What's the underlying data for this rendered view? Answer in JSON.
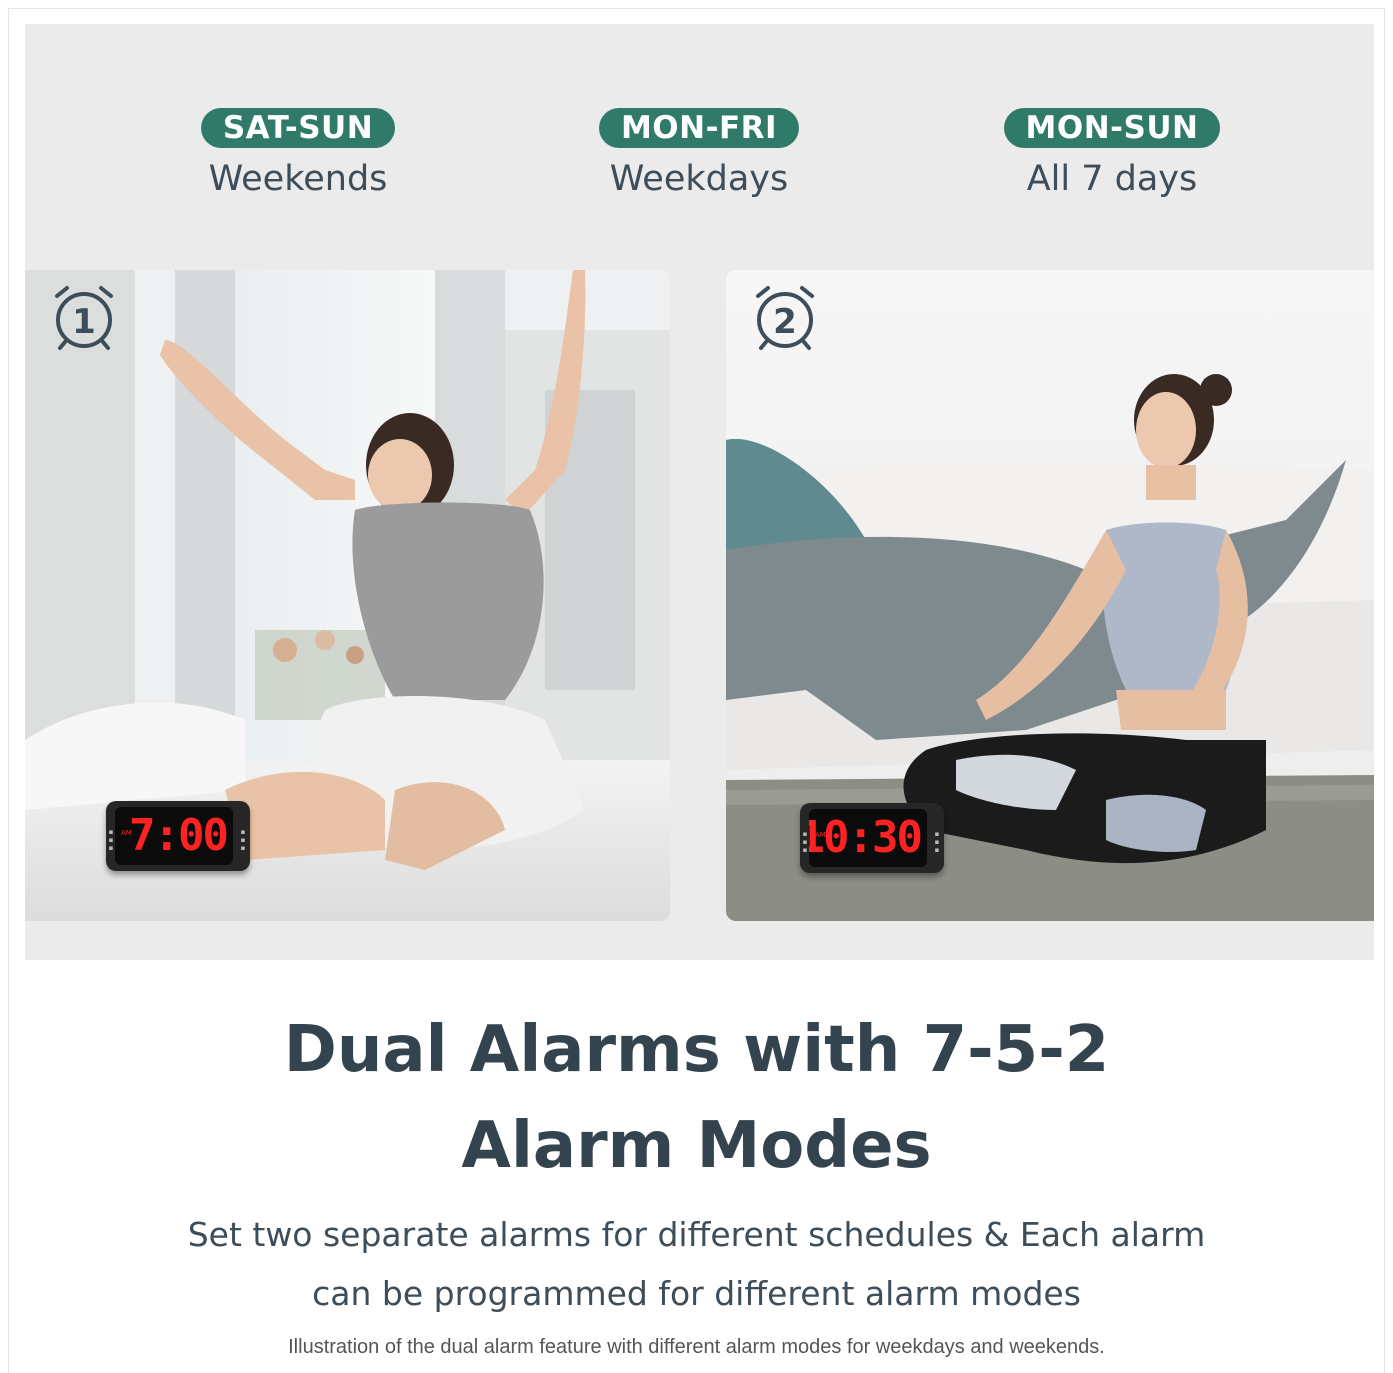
{
  "modes": [
    {
      "badge": "SAT-SUN",
      "label": "Weekends"
    },
    {
      "badge": "MON-FRI",
      "label": "Weekdays"
    },
    {
      "badge": "MON-SUN",
      "label": "All 7 days"
    }
  ],
  "photos": [
    {
      "alarm_number": "1",
      "scene": "woman-stretching-on-bed",
      "clock": {
        "time": "7:00",
        "indicator": "AM"
      }
    },
    {
      "alarm_number": "2",
      "scene": "woman-meditating-on-rug",
      "clock": {
        "time": "10:30",
        "indicator": "AM"
      }
    }
  ],
  "headline": {
    "line1": "Dual Alarms with 7-5-2",
    "line2": "Alarm Modes"
  },
  "description": {
    "line1": "Set two separate alarms for different schedules & Each alarm",
    "line2": "can be programmed for different alarm modes"
  },
  "caption": "Illustration of the dual alarm feature with different alarm modes for weekdays and weekends.",
  "colors": {
    "badge": "#2f7a69",
    "text": "#34444f",
    "panel": "#ebebeb",
    "led": "#ff2222"
  },
  "icons": {
    "alarm": "alarm-clock-icon"
  }
}
